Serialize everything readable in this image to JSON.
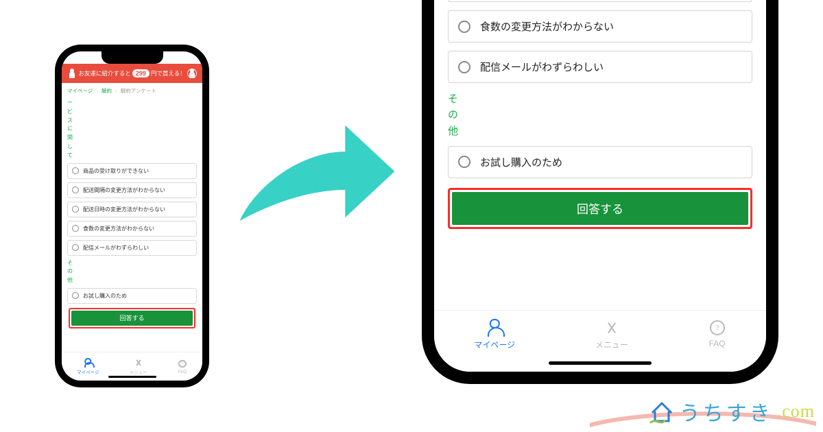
{
  "promo": {
    "text_before": "お友達に紹介すると",
    "price": "299",
    "text_after": "円で買える！"
  },
  "breadcrumbs": {
    "a": "マイページ",
    "b": "解約",
    "c": "解約アンケート"
  },
  "section_service_label": "サ｜ビスに関して",
  "section_other_label": "その他",
  "options_service": [
    "商品の受け取りができない",
    "配送間隔の変更方法がわからない",
    "配送日時の変更方法がわからない",
    "食数の変更方法がわからない",
    "配信メールがわずらわしい"
  ],
  "options_other": [
    "お試し購入のため"
  ],
  "submit_label": "回答する",
  "nav": {
    "mypage": "マイページ",
    "menu": "メニュー",
    "faq": "FAQ"
  },
  "watermark": {
    "text_jp": "うちすき",
    "text_dot": ".",
    "text_com": "com"
  }
}
